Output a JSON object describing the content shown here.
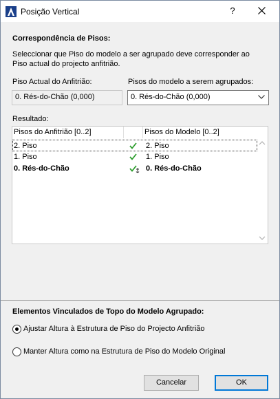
{
  "window": {
    "title": "Posição Vertical",
    "help": "?"
  },
  "floors_section": {
    "title": "Correspondência de Pisos:",
    "description_line1": "Seleccionar que Piso do modelo a ser agrupado deve corresponder ao",
    "description_line2": "Piso actual do projecto anfitrião."
  },
  "host_floor": {
    "label": "Piso Actual do Anfitrião:",
    "value": "0. Rés-do-Chão (0,000)"
  },
  "model_floors": {
    "label": "Pisos do modelo a serem agrupados:",
    "selected": "0. Rés-do-Chão (0,000)"
  },
  "result": {
    "label": "Resultado:",
    "columns": [
      "Pisos do Anfitrião [0..2]",
      "",
      "Pisos do Modelo [0..2]"
    ],
    "rows": [
      {
        "host": "2. Piso",
        "model": "2. Piso",
        "status": "check"
      },
      {
        "host": "1. Piso",
        "model": "1. Piso",
        "status": "check"
      },
      {
        "host": "0. Rés-do-Chão",
        "model": "0. Rés-do-Chão",
        "status": "check-anchor"
      }
    ]
  },
  "linked_section": {
    "title": "Elementos Vinculados de Topo do Modelo Agrupado:",
    "option1": "Ajustar Altura à Estrutura de Piso do Projecto Anfitrião",
    "option2": "Manter Altura como na Estrutura de Piso do Modelo Original",
    "selected": "option1"
  },
  "buttons": {
    "cancel": "Cancelar",
    "ok": "OK"
  },
  "colors": {
    "check": "#2e9e2e",
    "accent": "#0078d7"
  }
}
